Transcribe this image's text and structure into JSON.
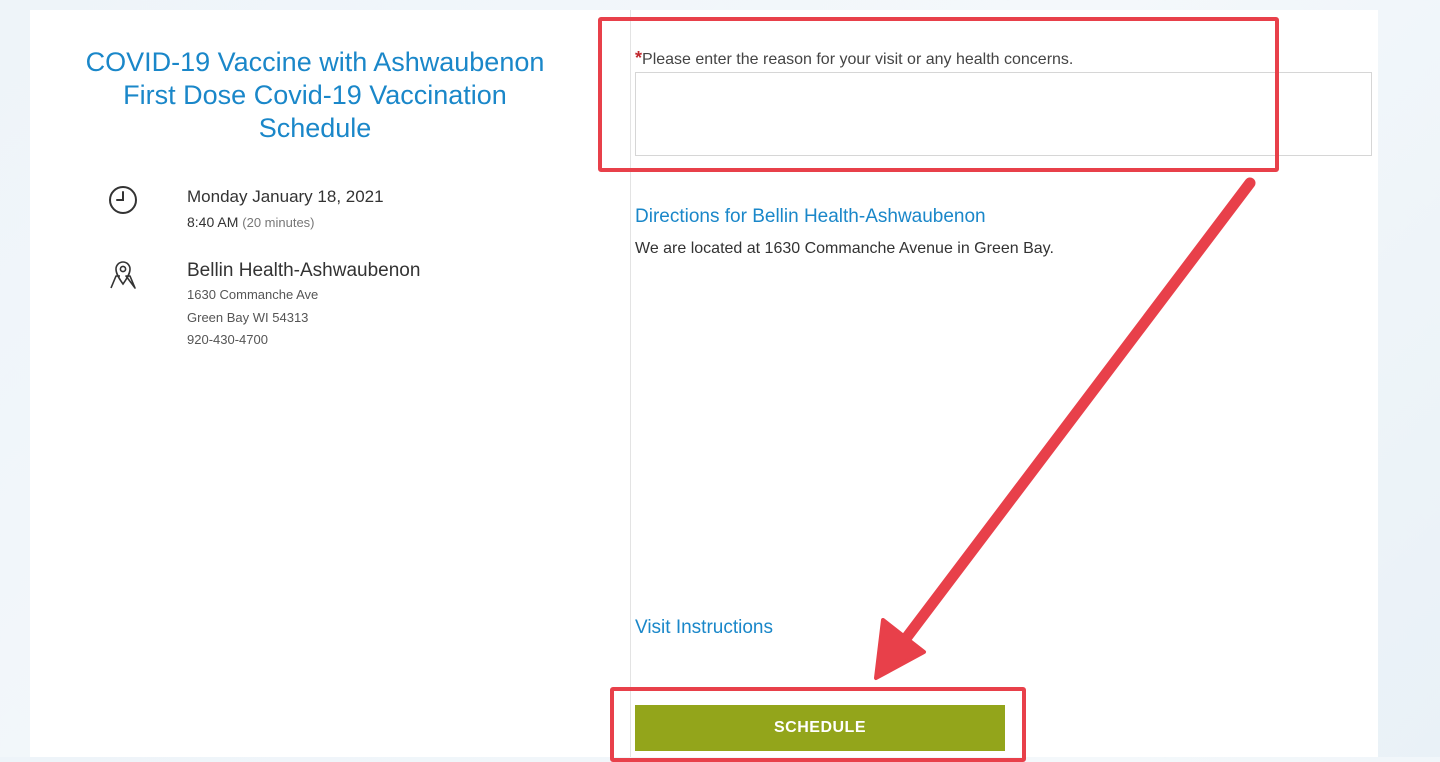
{
  "appointment": {
    "title": "COVID-19 Vaccine with Ashwaubenon First Dose Covid-19 Vaccination Schedule",
    "date": "Monday January 18, 2021",
    "time": "8:40 AM",
    "duration": "(20 minutes)"
  },
  "location": {
    "name": "Bellin Health-Ashwaubenon",
    "address_line1": "1630 Commanche Ave",
    "address_line2": "Green Bay WI 54313",
    "phone": "920-430-4700"
  },
  "icons": {
    "clock": "clock-icon",
    "location": "map-pin-icon"
  },
  "form": {
    "required_marker": "*",
    "reason_label": "Please enter the reason for your visit or any health concerns.",
    "reason_value": ""
  },
  "directions": {
    "link_label": "Directions for Bellin Health-Ashwaubenon",
    "text": "We are located at 1630 Commanche Avenue in Green Bay."
  },
  "visit_instructions_label": "Visit Instructions",
  "schedule_label": "SCHEDULE",
  "colors": {
    "accent_blue": "#1a87c9",
    "button_green": "#93a51b",
    "annotation_red": "#e8404a",
    "required_red": "#c0282d"
  }
}
